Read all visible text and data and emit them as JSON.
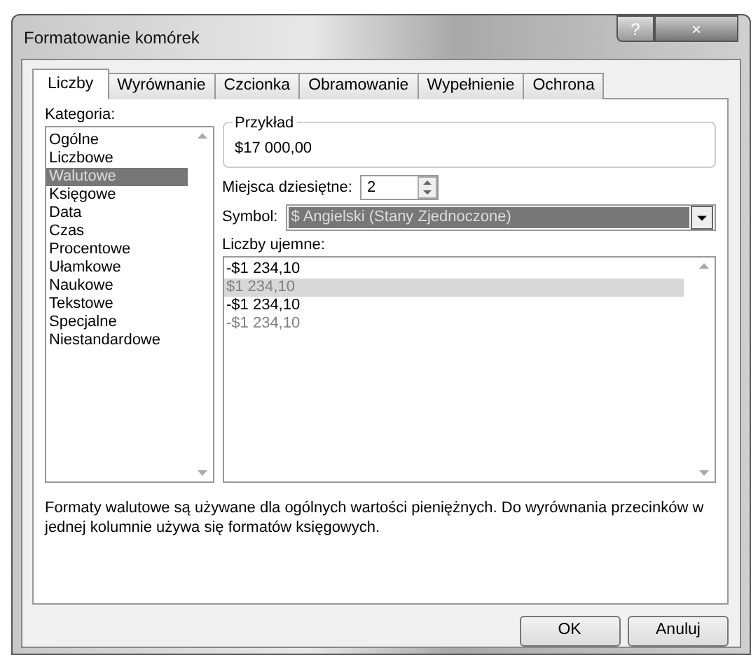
{
  "window": {
    "title": "Formatowanie komórek",
    "buttons": [
      "?",
      "×"
    ]
  },
  "tabs": [
    {
      "label": "Liczby",
      "selected": true
    },
    {
      "label": "Wyrównanie",
      "selected": false
    },
    {
      "label": "Czcionka",
      "selected": false
    },
    {
      "label": "Obramowanie",
      "selected": false
    },
    {
      "label": "Wypełnienie",
      "selected": false
    },
    {
      "label": "Ochrona",
      "selected": false
    }
  ],
  "category": {
    "label": "Kategoria:",
    "items": [
      {
        "label": "Ogólne",
        "selected": false
      },
      {
        "label": "Liczbowe",
        "selected": false
      },
      {
        "label": "Walutowe",
        "selected": true
      },
      {
        "label": "Księgowe",
        "selected": false
      },
      {
        "label": "Data",
        "selected": false
      },
      {
        "label": "Czas",
        "selected": false
      },
      {
        "label": "Procentowe",
        "selected": false
      },
      {
        "label": "Ułamkowe",
        "selected": false
      },
      {
        "label": "Naukowe",
        "selected": false
      },
      {
        "label": "Tekstowe",
        "selected": false
      },
      {
        "label": "Specjalne",
        "selected": false
      },
      {
        "label": "Niestandardowe",
        "selected": false
      }
    ]
  },
  "sample": {
    "label": "Przykład",
    "value": "$17 000,00"
  },
  "decimal_places": {
    "label": "Miejsca dziesiętne:",
    "value": "2"
  },
  "symbol": {
    "label": "Symbol:",
    "value": "$ Angielski (Stany Zjednoczone)"
  },
  "negative_numbers": {
    "label": "Liczby ujemne:",
    "items": [
      {
        "label": "-$1 234,10",
        "selected": false,
        "color": "#000000"
      },
      {
        "label": "$1 234,10",
        "selected": true,
        "color": "#808080"
      },
      {
        "label": "-$1 234,10",
        "selected": false,
        "color": "#000000"
      },
      {
        "label": "-$1 234,10",
        "selected": false,
        "color": "#808080"
      }
    ]
  },
  "description": "Formaty walutowe są używane dla ogólnych wartości pieniężnych. Do wyrównania przecinków w jednej kolumnie używa się formatów księgowych.",
  "buttons": [
    "OK",
    "Anuluj"
  ]
}
